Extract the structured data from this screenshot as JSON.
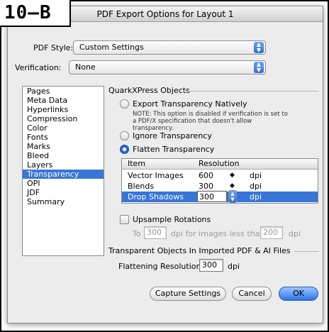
{
  "figure_label": "10–B",
  "window": {
    "title": "PDF Export Options for Layout 1"
  },
  "pdf_style": {
    "label": "PDF Style:",
    "value": "Custom Settings"
  },
  "verification": {
    "label": "Verification:",
    "value": "None"
  },
  "sidebar": {
    "items": [
      "Pages",
      "Meta Data",
      "Hyperlinks",
      "Compression",
      "Color",
      "Fonts",
      "Marks",
      "Bleed",
      "Layers",
      "Transparency",
      "OPI",
      "JDF",
      "Summary"
    ],
    "selected": "Transparency"
  },
  "quarkxpress_objects": {
    "title": "QuarkXPress Objects",
    "export_native_label": "Export Transparency Natively",
    "note": "NOTE: This option is disabled if verification is set to a PDF/X specification that doesn't allow transparency.",
    "ignore_label": "Ignore Transparency",
    "flatten_label": "Flatten Transparency",
    "selected": "Flatten Transparency"
  },
  "table": {
    "headers": {
      "item": "Item",
      "resolution": "Resolution"
    },
    "rows": [
      {
        "item": "Vector Images",
        "resolution": "600",
        "unit": "dpi"
      },
      {
        "item": "Blends",
        "resolution": "300",
        "unit": "dpi"
      },
      {
        "item": "Drop Shadows",
        "resolution": "300",
        "unit": "dpi"
      }
    ]
  },
  "upsample": {
    "label": "Upsample Rotations",
    "checked": false,
    "to_label": "To",
    "to_value": "300",
    "mid_label": "dpi for images less than",
    "less_value": "200",
    "end_label": "dpi"
  },
  "imported": {
    "title": "Transparent Objects In Imported PDF & AI Files",
    "flattening_label": "Flattening Resolution:",
    "flattening_value": "300",
    "unit": "dpi"
  },
  "buttons": {
    "capture": "Capture Settings",
    "cancel": "Cancel",
    "ok": "OK"
  }
}
